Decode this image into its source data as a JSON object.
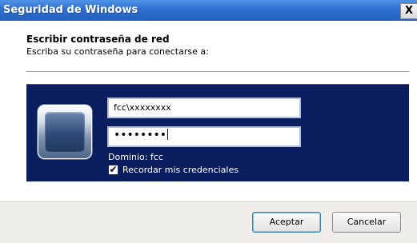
{
  "window": {
    "title": "Seguridad de Windows",
    "close_label": "X"
  },
  "dialog": {
    "heading": "Escribir contraseña de red",
    "subheading": "Escriba su contraseña para conectarse a:"
  },
  "credentials": {
    "tile_icon": "user-tile-icon",
    "username_value": "fcc\\xxxxxxxx",
    "password_masked": "••••••••",
    "domain_text": "Dominio: fcc",
    "remember_label": "Recordar mis credenciales",
    "remember_checked": true,
    "checkmark": "✔"
  },
  "buttons": {
    "ok_label": "Aceptar",
    "cancel_label": "Cancelar"
  },
  "colors": {
    "titlebar": "#2f6fd1",
    "panel": "#0a1e5f",
    "footer": "#f0eeea"
  }
}
